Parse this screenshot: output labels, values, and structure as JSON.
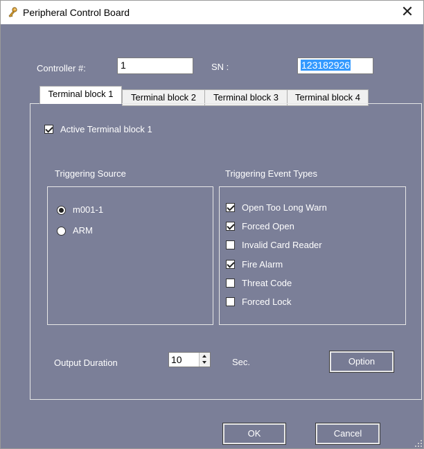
{
  "window": {
    "title": "Peripheral Control Board",
    "close_glyph": "✕"
  },
  "form": {
    "controller_label": "Controller #:",
    "controller_value": "1",
    "sn_label": "SN :",
    "sn_value": "123182926"
  },
  "tabs": [
    {
      "label": "Terminal block 1",
      "active": true
    },
    {
      "label": "Terminal block 2",
      "active": false
    },
    {
      "label": "Terminal block 3",
      "active": false
    },
    {
      "label": "Terminal block 4",
      "active": false
    }
  ],
  "panel": {
    "active_label": "Active Terminal block 1",
    "active_checked": true,
    "triggering_source": {
      "title": "Triggering Source",
      "options": [
        {
          "label": "m001-1",
          "checked": true
        },
        {
          "label": "ARM",
          "checked": false
        }
      ]
    },
    "triggering_events": {
      "title": "Triggering Event Types",
      "items": [
        {
          "label": "Open Too Long Warn",
          "checked": true
        },
        {
          "label": "Forced Open",
          "checked": true
        },
        {
          "label": "Invalid Card Reader",
          "checked": false
        },
        {
          "label": "Fire Alarm",
          "checked": true
        },
        {
          "label": "Threat Code",
          "checked": false
        },
        {
          "label": "Forced Lock",
          "checked": false
        }
      ]
    },
    "output_duration_label": "Output Duration",
    "output_duration_value": "10",
    "sec_label": "Sec.",
    "option_button": "Option"
  },
  "buttons": {
    "ok": "OK",
    "cancel": "Cancel"
  },
  "colors": {
    "background": "#7b7f98",
    "selection": "#3399ff",
    "titlebar": "#ffffff"
  },
  "icons": {
    "app_icon": "key-person-icon",
    "close": "close-icon"
  }
}
